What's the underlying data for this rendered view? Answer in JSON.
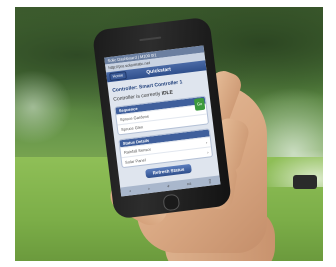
{
  "app": {
    "statusbar_text": "Solic Dashboard | M100 0/1",
    "url_text": "http://pro.solarmatic.net",
    "nav_home": "Home",
    "nav_title": "Quickstart"
  },
  "controller": {
    "title": "Controller: Smart Controller 1",
    "state_prefix": "Controller is currently",
    "state_value": "IDLE"
  },
  "sections": {
    "schedule": {
      "header": "Sequence",
      "rows": [
        "Spruce Gardens",
        "Spruce Glen"
      ],
      "go_label": "Go"
    },
    "status": {
      "header": "Status Details",
      "rows": [
        "Rainfall Sensor",
        "Solar Panel"
      ]
    }
  },
  "refresh_label": "Refresh Status",
  "toolbar": {
    "items": [
      "‹",
      "›",
      "+",
      "▭",
      "▯"
    ]
  }
}
